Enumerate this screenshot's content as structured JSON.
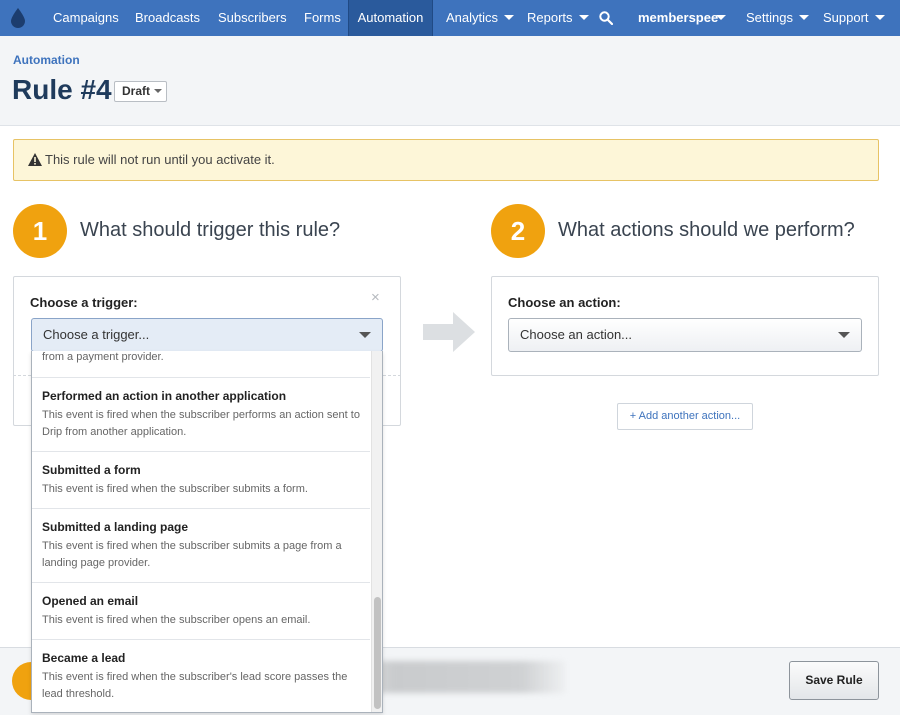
{
  "nav": {
    "items": [
      {
        "label": "Campaigns"
      },
      {
        "label": "Broadcasts"
      },
      {
        "label": "Subscribers"
      },
      {
        "label": "Forms"
      },
      {
        "label": "Automation"
      },
      {
        "label": "Analytics"
      },
      {
        "label": "Reports"
      },
      {
        "label": "memberspee"
      },
      {
        "label": "Settings"
      },
      {
        "label": "Support"
      }
    ],
    "active": "Automation",
    "color": "#3e73bd"
  },
  "header": {
    "breadcrumb": "Automation",
    "title": "Rule #4",
    "status": "Draft"
  },
  "warning": {
    "text": "This rule will not run until you activate it."
  },
  "trigger": {
    "number": "1",
    "heading": "What should trigger this rule?",
    "label": "Choose a trigger:",
    "select_value": "Choose a trigger...",
    "close": "×"
  },
  "action": {
    "number": "2",
    "heading": "What actions should we perform?",
    "label": "Choose an action:",
    "select_value": "Choose an action...",
    "add_button": "+ Add another action..."
  },
  "dropdown": {
    "partial_text": "from a payment provider.",
    "options": [
      {
        "title": "Performed an action in another application",
        "desc": "This event is fired when the subscriber performs an action sent to Drip from another application."
      },
      {
        "title": "Submitted a form",
        "desc": "This event is fired when the subscriber submits a form."
      },
      {
        "title": "Submitted a landing page",
        "desc": "This event is fired when the subscriber submits a page from a landing page provider."
      },
      {
        "title": "Opened an email",
        "desc": "This event is fired when the subscriber opens an email."
      },
      {
        "title": "Became a lead",
        "desc": "This event is fired when the subscriber's lead score passes the lead threshold."
      }
    ]
  },
  "footer": {
    "save_label": "Save Rule"
  },
  "colors": {
    "accent": "#f0a20f",
    "warning_bg": "#fdf6d8"
  }
}
